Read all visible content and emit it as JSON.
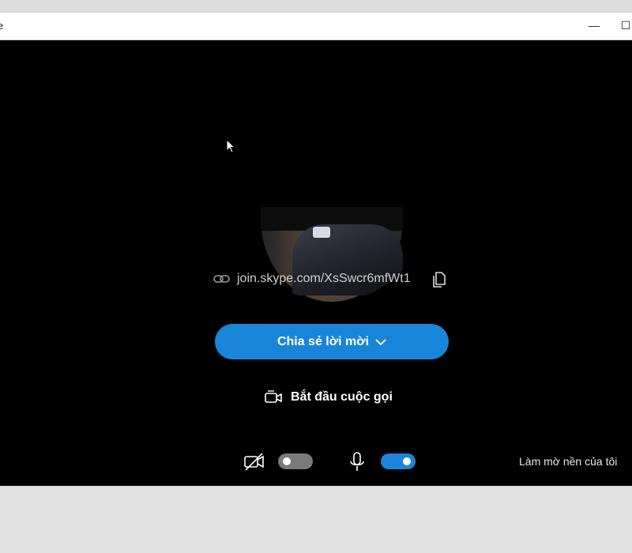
{
  "window": {
    "title_fragment": "e",
    "minimize_glyph": "—",
    "maximize_glyph": "☐"
  },
  "invite": {
    "link": "join.skype.com/XsSwcr6mfWt1",
    "share_button_label": "Chia sẻ lời mời",
    "start_call_label": "Bắt đầu cuộc gọi"
  },
  "controls": {
    "camera_toggle_on": false,
    "mic_toggle_on": true,
    "blur_background_label": "Làm mờ nền của tôi"
  },
  "colors": {
    "accent": "#1985d8",
    "stage_bg": "#000000",
    "toggle_off": "#7a7a7a"
  },
  "icons": [
    "link-icon",
    "copy-icon",
    "chevron-down-icon",
    "video-call-icon",
    "camera-off-icon",
    "microphone-icon",
    "mouse-cursor"
  ]
}
